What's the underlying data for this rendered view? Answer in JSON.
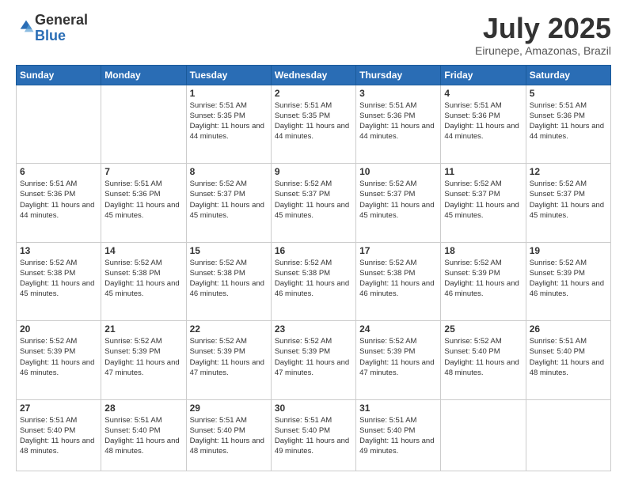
{
  "header": {
    "logo_general": "General",
    "logo_blue": "Blue",
    "month_title": "July 2025",
    "location": "Eirunepe, Amazonas, Brazil"
  },
  "days_of_week": [
    "Sunday",
    "Monday",
    "Tuesday",
    "Wednesday",
    "Thursday",
    "Friday",
    "Saturday"
  ],
  "weeks": [
    [
      {
        "day": "",
        "info": ""
      },
      {
        "day": "",
        "info": ""
      },
      {
        "day": "1",
        "info": "Sunrise: 5:51 AM\nSunset: 5:35 PM\nDaylight: 11 hours and 44 minutes."
      },
      {
        "day": "2",
        "info": "Sunrise: 5:51 AM\nSunset: 5:35 PM\nDaylight: 11 hours and 44 minutes."
      },
      {
        "day": "3",
        "info": "Sunrise: 5:51 AM\nSunset: 5:36 PM\nDaylight: 11 hours and 44 minutes."
      },
      {
        "day": "4",
        "info": "Sunrise: 5:51 AM\nSunset: 5:36 PM\nDaylight: 11 hours and 44 minutes."
      },
      {
        "day": "5",
        "info": "Sunrise: 5:51 AM\nSunset: 5:36 PM\nDaylight: 11 hours and 44 minutes."
      }
    ],
    [
      {
        "day": "6",
        "info": "Sunrise: 5:51 AM\nSunset: 5:36 PM\nDaylight: 11 hours and 44 minutes."
      },
      {
        "day": "7",
        "info": "Sunrise: 5:51 AM\nSunset: 5:36 PM\nDaylight: 11 hours and 45 minutes."
      },
      {
        "day": "8",
        "info": "Sunrise: 5:52 AM\nSunset: 5:37 PM\nDaylight: 11 hours and 45 minutes."
      },
      {
        "day": "9",
        "info": "Sunrise: 5:52 AM\nSunset: 5:37 PM\nDaylight: 11 hours and 45 minutes."
      },
      {
        "day": "10",
        "info": "Sunrise: 5:52 AM\nSunset: 5:37 PM\nDaylight: 11 hours and 45 minutes."
      },
      {
        "day": "11",
        "info": "Sunrise: 5:52 AM\nSunset: 5:37 PM\nDaylight: 11 hours and 45 minutes."
      },
      {
        "day": "12",
        "info": "Sunrise: 5:52 AM\nSunset: 5:37 PM\nDaylight: 11 hours and 45 minutes."
      }
    ],
    [
      {
        "day": "13",
        "info": "Sunrise: 5:52 AM\nSunset: 5:38 PM\nDaylight: 11 hours and 45 minutes."
      },
      {
        "day": "14",
        "info": "Sunrise: 5:52 AM\nSunset: 5:38 PM\nDaylight: 11 hours and 45 minutes."
      },
      {
        "day": "15",
        "info": "Sunrise: 5:52 AM\nSunset: 5:38 PM\nDaylight: 11 hours and 46 minutes."
      },
      {
        "day": "16",
        "info": "Sunrise: 5:52 AM\nSunset: 5:38 PM\nDaylight: 11 hours and 46 minutes."
      },
      {
        "day": "17",
        "info": "Sunrise: 5:52 AM\nSunset: 5:38 PM\nDaylight: 11 hours and 46 minutes."
      },
      {
        "day": "18",
        "info": "Sunrise: 5:52 AM\nSunset: 5:39 PM\nDaylight: 11 hours and 46 minutes."
      },
      {
        "day": "19",
        "info": "Sunrise: 5:52 AM\nSunset: 5:39 PM\nDaylight: 11 hours and 46 minutes."
      }
    ],
    [
      {
        "day": "20",
        "info": "Sunrise: 5:52 AM\nSunset: 5:39 PM\nDaylight: 11 hours and 46 minutes."
      },
      {
        "day": "21",
        "info": "Sunrise: 5:52 AM\nSunset: 5:39 PM\nDaylight: 11 hours and 47 minutes."
      },
      {
        "day": "22",
        "info": "Sunrise: 5:52 AM\nSunset: 5:39 PM\nDaylight: 11 hours and 47 minutes."
      },
      {
        "day": "23",
        "info": "Sunrise: 5:52 AM\nSunset: 5:39 PM\nDaylight: 11 hours and 47 minutes."
      },
      {
        "day": "24",
        "info": "Sunrise: 5:52 AM\nSunset: 5:39 PM\nDaylight: 11 hours and 47 minutes."
      },
      {
        "day": "25",
        "info": "Sunrise: 5:52 AM\nSunset: 5:40 PM\nDaylight: 11 hours and 48 minutes."
      },
      {
        "day": "26",
        "info": "Sunrise: 5:51 AM\nSunset: 5:40 PM\nDaylight: 11 hours and 48 minutes."
      }
    ],
    [
      {
        "day": "27",
        "info": "Sunrise: 5:51 AM\nSunset: 5:40 PM\nDaylight: 11 hours and 48 minutes."
      },
      {
        "day": "28",
        "info": "Sunrise: 5:51 AM\nSunset: 5:40 PM\nDaylight: 11 hours and 48 minutes."
      },
      {
        "day": "29",
        "info": "Sunrise: 5:51 AM\nSunset: 5:40 PM\nDaylight: 11 hours and 48 minutes."
      },
      {
        "day": "30",
        "info": "Sunrise: 5:51 AM\nSunset: 5:40 PM\nDaylight: 11 hours and 49 minutes."
      },
      {
        "day": "31",
        "info": "Sunrise: 5:51 AM\nSunset: 5:40 PM\nDaylight: 11 hours and 49 minutes."
      },
      {
        "day": "",
        "info": ""
      },
      {
        "day": "",
        "info": ""
      }
    ]
  ]
}
